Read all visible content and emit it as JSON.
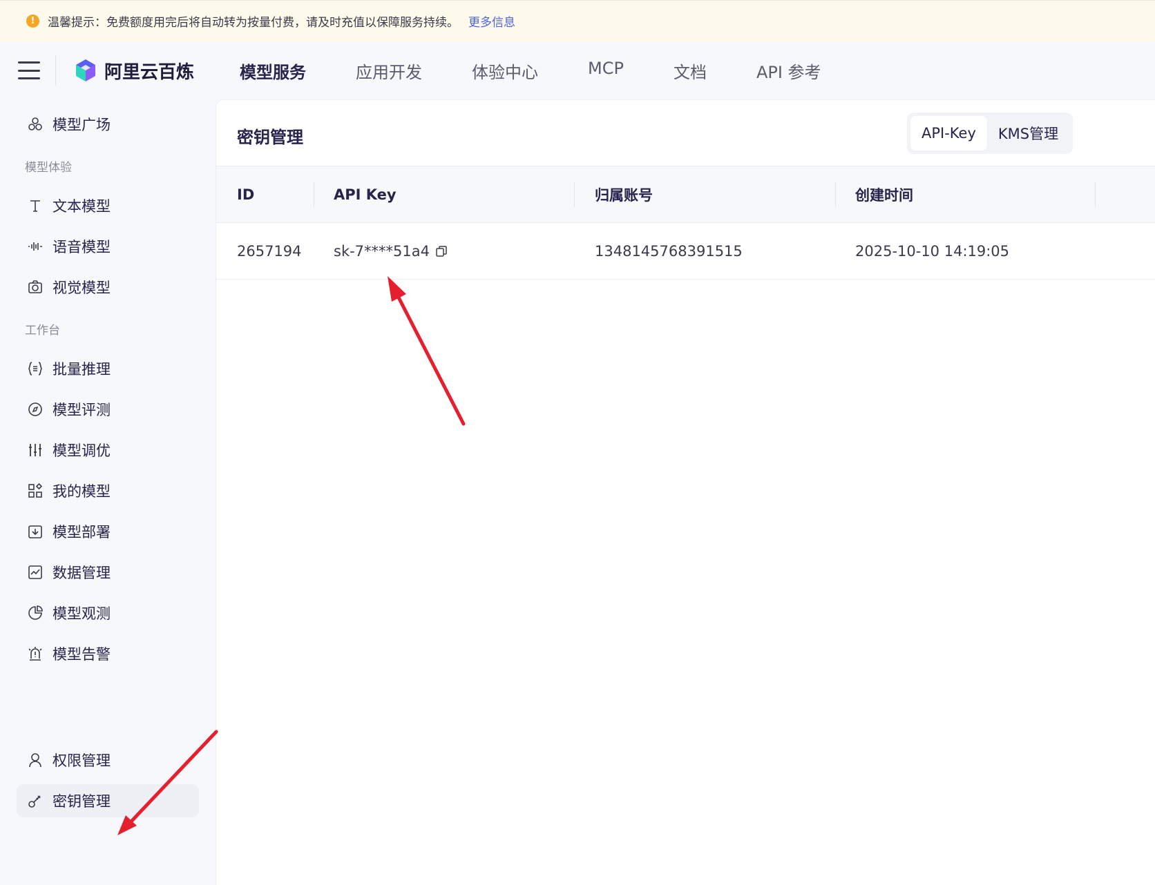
{
  "notice": {
    "text": "温馨提示：免费额度用完后将自动转为按量付费，请及时充值以保障服务持续。",
    "link": "更多信息",
    "icon": "warning-icon",
    "color": "#f5a623"
  },
  "brand": {
    "name": "阿里云百炼"
  },
  "nav": [
    {
      "label": "模型服务",
      "active": true
    },
    {
      "label": "应用开发"
    },
    {
      "label": "体验中心"
    },
    {
      "label": "MCP"
    },
    {
      "label": "文档"
    },
    {
      "label": "API 参考"
    }
  ],
  "sidebar": {
    "plaza": {
      "label": "模型广场",
      "icon": "model-plaza-icon"
    },
    "group1": "模型体验",
    "group1_items": [
      {
        "label": "文本模型",
        "icon": "text-icon"
      },
      {
        "label": "语音模型",
        "icon": "audio-wave-icon"
      },
      {
        "label": "视觉模型",
        "icon": "camera-icon"
      }
    ],
    "group2": "工作台",
    "group2_items": [
      {
        "label": "批量推理",
        "icon": "braces-icon"
      },
      {
        "label": "模型评测",
        "icon": "compass-icon"
      },
      {
        "label": "模型调优",
        "icon": "sliders-icon"
      },
      {
        "label": "我的模型",
        "icon": "grid-apps-icon"
      },
      {
        "label": "模型部署",
        "icon": "deploy-icon"
      },
      {
        "label": "数据管理",
        "icon": "chart-line-icon"
      },
      {
        "label": "模型观测",
        "icon": "pie-chart-icon"
      },
      {
        "label": "模型告警",
        "icon": "alarm-icon"
      }
    ],
    "bottom_items": [
      {
        "label": "权限管理",
        "icon": "user-icon"
      },
      {
        "label": "密钥管理",
        "icon": "key-icon",
        "active": true
      }
    ]
  },
  "page": {
    "title": "密钥管理",
    "tabs": [
      {
        "label": "API-Key",
        "active": true
      },
      {
        "label": "KMS管理"
      }
    ]
  },
  "table": {
    "headers": [
      "ID",
      "API Key",
      "归属账号",
      "创建时间"
    ],
    "rows": [
      {
        "id": "2657194",
        "api_key": "sk-7****51a4",
        "account": "1348145768391515",
        "created": "2025-10-10 14:19:05"
      }
    ]
  },
  "colors": {
    "accent_link": "#4c63e6",
    "annotation_arrow": "#e5202e"
  }
}
